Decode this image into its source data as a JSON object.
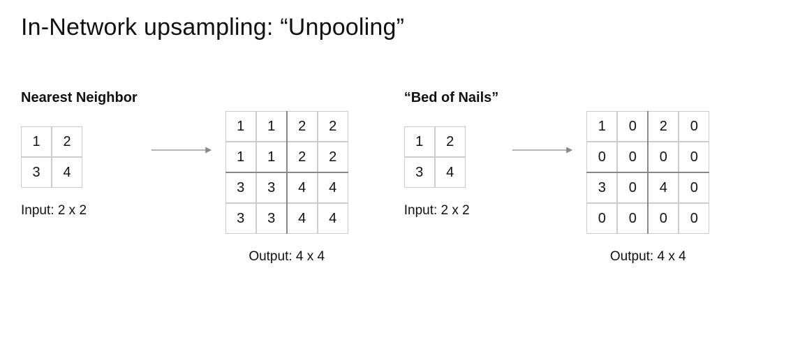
{
  "title": "In-Network upsampling: “Unpooling”",
  "methods": [
    {
      "name": "Nearest Neighbor",
      "input_label": "Input: 2 x 2",
      "output_label": "Output: 4 x 4",
      "input_grid": [
        [
          1,
          2
        ],
        [
          3,
          4
        ]
      ],
      "output_grid": [
        [
          1,
          1,
          2,
          2
        ],
        [
          1,
          1,
          2,
          2
        ],
        [
          3,
          3,
          4,
          4
        ],
        [
          3,
          3,
          4,
          4
        ]
      ]
    },
    {
      "name": "“Bed of Nails”",
      "input_label": "Input: 2 x 2",
      "output_label": "Output: 4 x 4",
      "input_grid": [
        [
          1,
          2
        ],
        [
          3,
          4
        ]
      ],
      "output_grid": [
        [
          1,
          0,
          2,
          0
        ],
        [
          0,
          0,
          0,
          0
        ],
        [
          3,
          0,
          4,
          0
        ],
        [
          0,
          0,
          0,
          0
        ]
      ]
    }
  ]
}
